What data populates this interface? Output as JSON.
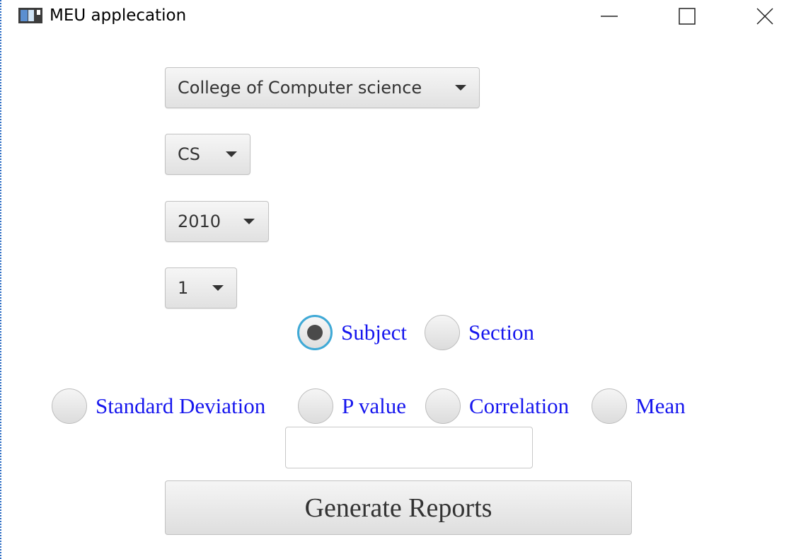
{
  "window": {
    "title": "MEU applecation"
  },
  "combos": {
    "college": "College of Computer science",
    "department": "CS",
    "year": "2010",
    "level": "1"
  },
  "report_type": {
    "subject": "Subject",
    "section": "Section",
    "selected": "Subject"
  },
  "statistics": {
    "standard_deviation": "Standard Deviation",
    "p_value": "P value",
    "correlation": "Correlation",
    "mean": "Mean"
  },
  "result_field": {
    "value": "",
    "placeholder": ""
  },
  "actions": {
    "generate_label": "Generate Reports"
  },
  "icons": {
    "app": "app-window-icon",
    "minimize": "minimize-icon",
    "maximize": "maximize-icon",
    "close": "close-icon",
    "dropdown": "chevron-down-icon"
  },
  "colors": {
    "radio_label": "#1616ee",
    "radio_focus_ring": "#3fa9d6",
    "control_text": "#333333"
  }
}
